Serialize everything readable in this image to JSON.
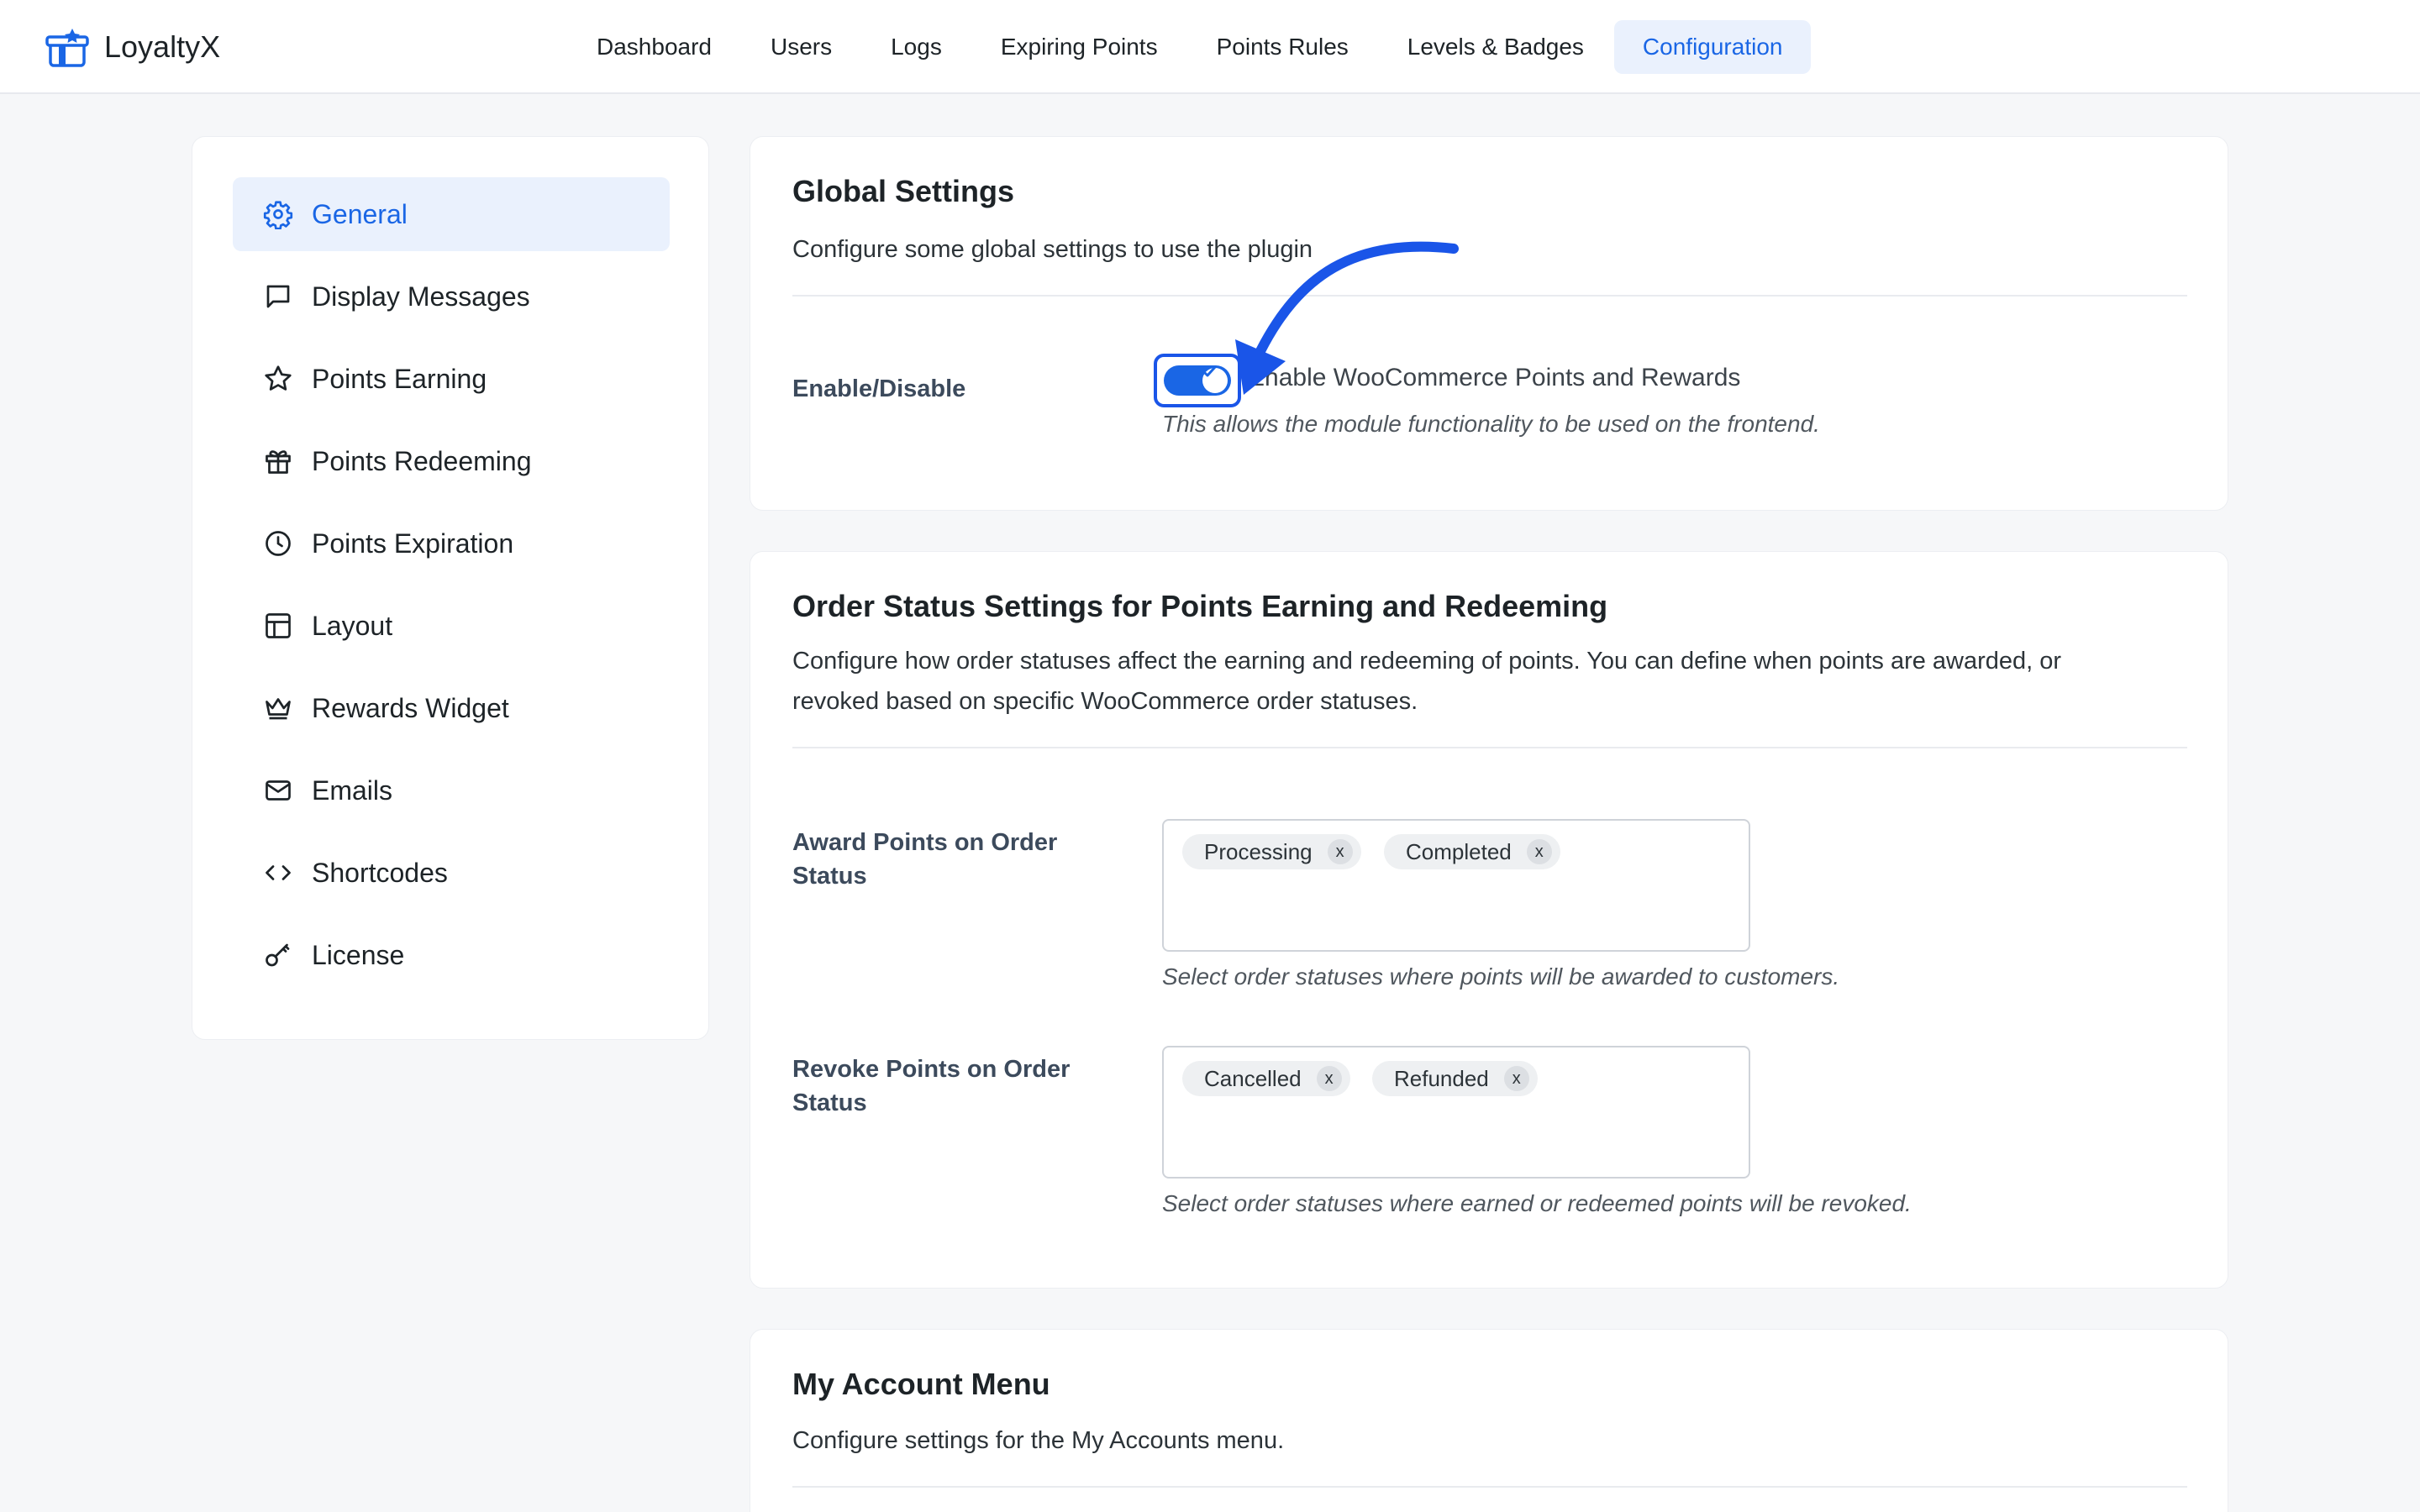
{
  "app": {
    "name": "LoyaltyX",
    "logo_icon": "gift-box-icon",
    "accent": "#1a66e5"
  },
  "nav": {
    "items": [
      {
        "label": "Dashboard"
      },
      {
        "label": "Users"
      },
      {
        "label": "Logs"
      },
      {
        "label": "Expiring Points"
      },
      {
        "label": "Points Rules"
      },
      {
        "label": "Levels & Badges"
      },
      {
        "label": "Configuration",
        "active": true
      }
    ]
  },
  "sidebar": {
    "items": [
      {
        "label": "General",
        "icon": "gear-icon",
        "active": true
      },
      {
        "label": "Display Messages",
        "icon": "message-icon"
      },
      {
        "label": "Points Earning",
        "icon": "star-icon"
      },
      {
        "label": "Points Redeeming",
        "icon": "gift-icon"
      },
      {
        "label": "Points Expiration",
        "icon": "clock-icon"
      },
      {
        "label": "Layout",
        "icon": "layout-icon"
      },
      {
        "label": "Rewards Widget",
        "icon": "crown-icon"
      },
      {
        "label": "Emails",
        "icon": "mail-icon"
      },
      {
        "label": "Shortcodes",
        "icon": "code-icon"
      },
      {
        "label": "License",
        "icon": "key-icon"
      }
    ]
  },
  "global": {
    "title": "Global Settings",
    "description": "Configure some global settings to use the plugin",
    "enable_label": "Enable/Disable",
    "toggle_on": true,
    "toggle_text": "Enable WooCommerce Points and Rewards",
    "toggle_help": "This allows the module functionality to be used on the frontend."
  },
  "order_status": {
    "title": "Order Status Settings for Points Earning and Redeeming",
    "description_line1": "Configure how order statuses affect the earning and redeeming of points. You can define when points are awarded, or",
    "description_line2": "revoked based on specific WooCommerce order statuses.",
    "award": {
      "label_line1": "Award Points on Order",
      "label_line2": "Status",
      "chips": [
        "Processing",
        "Completed"
      ],
      "help": "Select order statuses where points will be awarded to customers."
    },
    "revoke": {
      "label_line1": "Revoke Points on Order",
      "label_line2": "Status",
      "chips": [
        "Cancelled",
        "Refunded"
      ],
      "help": "Select order statuses where earned or redeemed points will be revoked."
    },
    "chip_remove": "x"
  },
  "my_account": {
    "title": "My Account Menu",
    "description": "Configure settings for the My Accounts menu."
  }
}
